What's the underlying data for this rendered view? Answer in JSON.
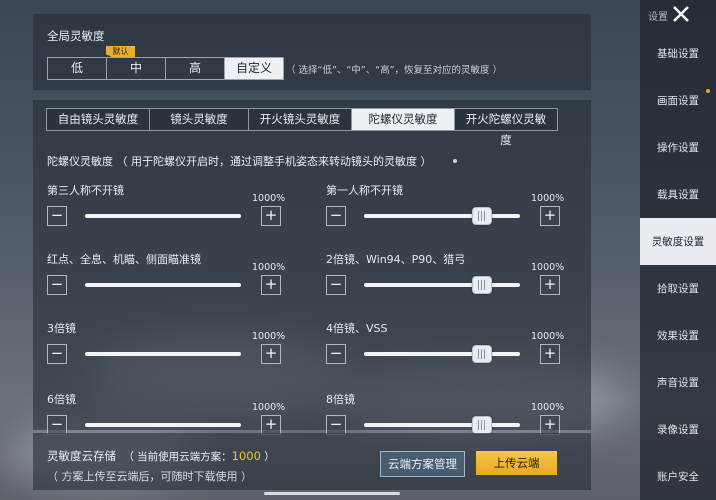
{
  "sidebar": {
    "title": "设置",
    "items": [
      {
        "label": "基础设置",
        "active": false,
        "dot": false
      },
      {
        "label": "画面设置",
        "active": false,
        "dot": true
      },
      {
        "label": "操作设置",
        "active": false,
        "dot": false
      },
      {
        "label": "载具设置",
        "active": false,
        "dot": false
      },
      {
        "label": "灵敏度设置",
        "active": true,
        "dot": false
      },
      {
        "label": "拾取设置",
        "active": false,
        "dot": false
      },
      {
        "label": "效果设置",
        "active": false,
        "dot": false
      },
      {
        "label": "声音设置",
        "active": false,
        "dot": false
      },
      {
        "label": "录像设置",
        "active": false,
        "dot": false
      },
      {
        "label": "账户安全",
        "active": false,
        "dot": false
      }
    ]
  },
  "global": {
    "title": "全局灵敏度",
    "default_tag": "默认",
    "options": [
      "低",
      "中",
      "高",
      "自定义"
    ],
    "selected": "自定义",
    "hint": "（ 选择“低”、“中”、“高”，恢复至对应的灵敏度 ）"
  },
  "tabs": {
    "items": [
      "自由镜头灵敏度",
      "镜头灵敏度",
      "开火镜头灵敏度",
      "陀螺仪灵敏度",
      "开火陀螺仪灵敏度"
    ],
    "selected": "陀螺仪灵敏度"
  },
  "gyro": {
    "title": "陀螺仪灵敏度 （ 用于陀螺仪开启时，通过调整手机姿态来转动镜头的灵敏度 ）"
  },
  "sliders": [
    {
      "label": "第三人称不开镜",
      "max_label": "1000%",
      "value": 1.0
    },
    {
      "label": "第一人称不开镜",
      "max_label": "1000%",
      "value": 0.78
    },
    {
      "label": "红点、全息、机瞄、侧面瞄准镜",
      "max_label": "1000%",
      "value": 1.0
    },
    {
      "label": "2倍镜、Win94、P90、猎弓",
      "max_label": "1000%",
      "value": 0.78
    },
    {
      "label": "3倍镜",
      "max_label": "1000%",
      "value": 1.0
    },
    {
      "label": "4倍镜、VSS",
      "max_label": "1000%",
      "value": 0.78
    },
    {
      "label": "6倍镜",
      "max_label": "1000%",
      "value": 1.0
    },
    {
      "label": "8倍镜",
      "max_label": "1000%",
      "value": 0.78
    }
  ],
  "controls": {
    "minus": "−",
    "plus": "+"
  },
  "cloud": {
    "title": "灵敏度云存储",
    "current_prefix": "（ 当前使用云端方案：",
    "current_value": "1000",
    "current_suffix": " ）",
    "subtitle": "（ 方案上传至云端后，可随时下载使用 ）",
    "manage_label": "云端方案管理",
    "upload_label": "上传云端"
  },
  "colors": {
    "accent": "#e8a823",
    "selected_bg": "#eef1f4"
  }
}
